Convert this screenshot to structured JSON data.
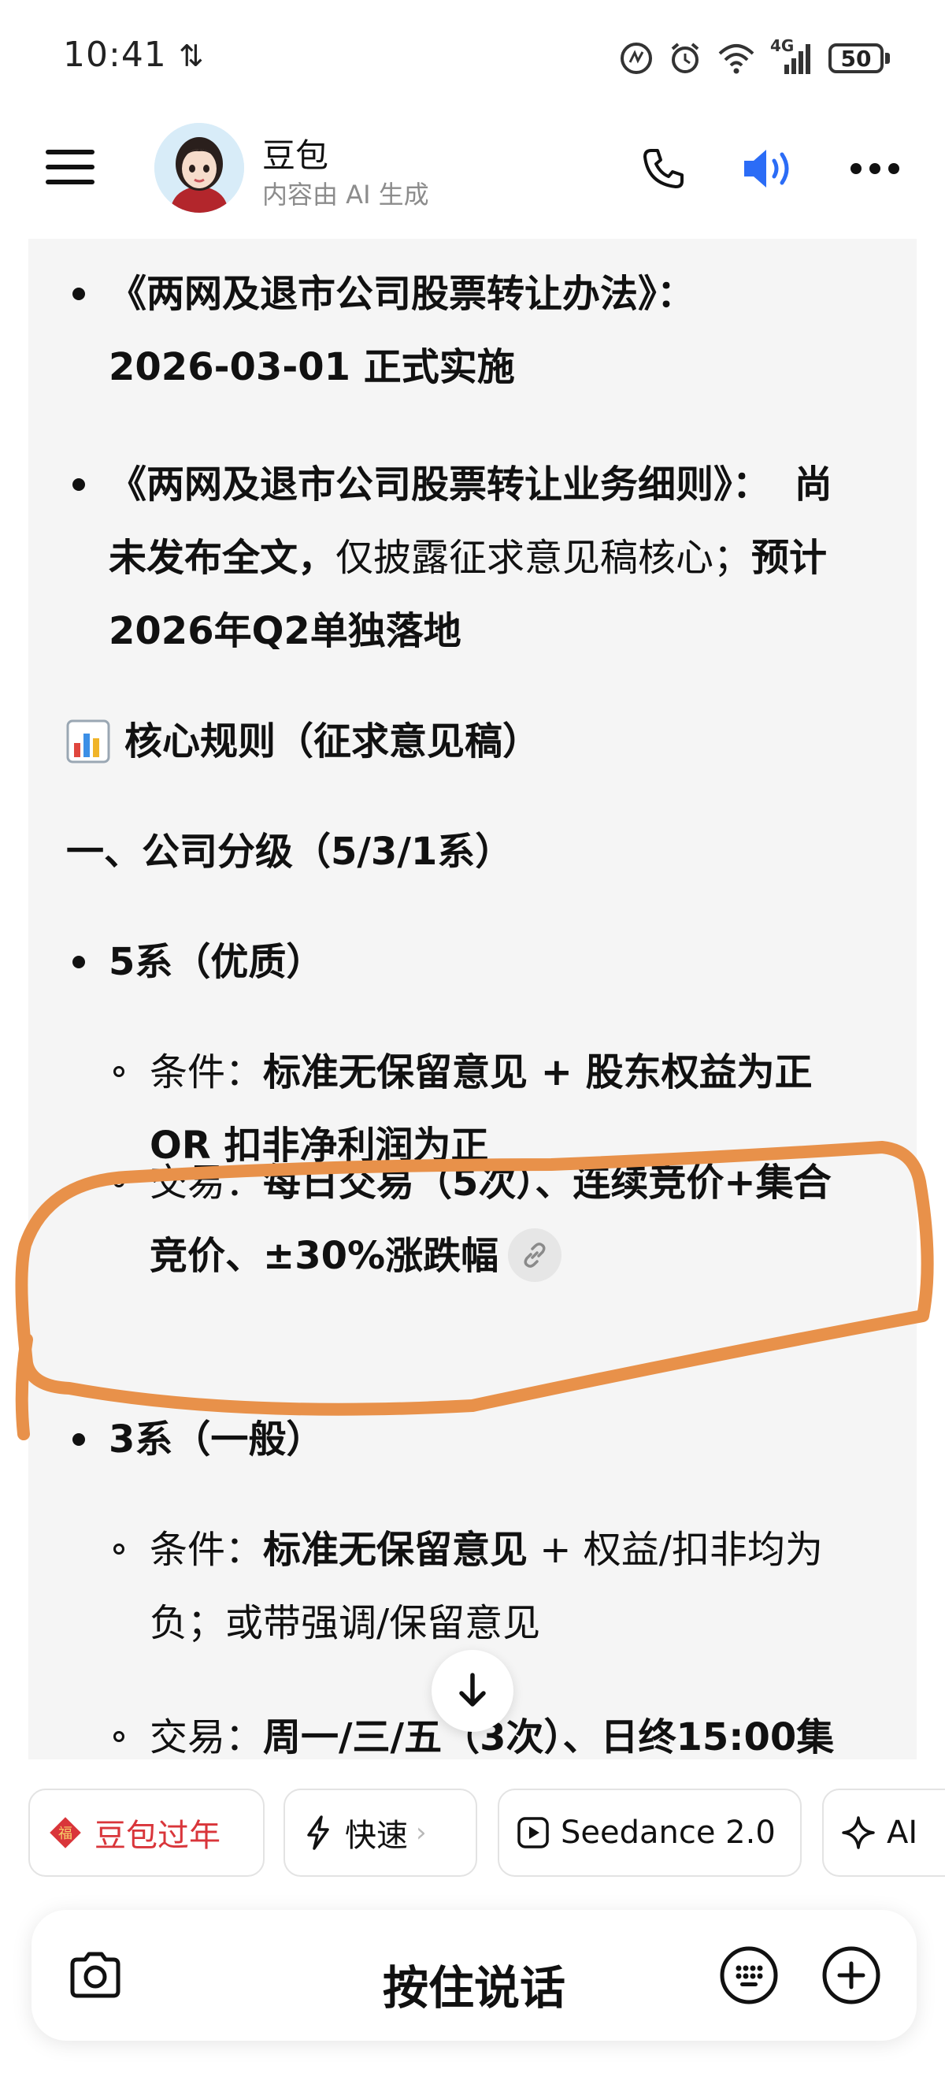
{
  "status_bar": {
    "time": "10:41",
    "network_arrows": "⇅",
    "network_type": "4G",
    "battery": "50"
  },
  "header": {
    "bot_name": "豆包",
    "subtitle": "内容由 AI 生成",
    "icons": [
      "menu-icon",
      "phone-icon",
      "speaker-icon",
      "more-icon"
    ],
    "accent_color": "#2b6cf6"
  },
  "content": {
    "item1_title": "《两网及退市公司股票转让办法》：",
    "item1_detail": "2026-03-01 正式实施",
    "item2_title": "《两网及退市公司股票转让业务细则》：",
    "item2_tail": "尚",
    "item2_line2_a": "未发布全文，",
    "item2_line2_b": "仅披露征求意见稿核心；",
    "item2_line2_c": "预计",
    "item2_line3": "2026年Q2单独落地",
    "section_heading": "核心规则（征求意见稿）",
    "subheading": "一、公司分级（5/3/1系）",
    "tier5": {
      "title": "5系（优质）",
      "cond_label": "条件：",
      "cond_line1": "标准无保留意见 + 股东权益为正",
      "cond_line2": "OR 扣非净利润为正",
      "trade_label": "交易：",
      "trade_line1": "每日交易（5次）、连续竞价+集合",
      "trade_line2": "竞价、±30%涨跌幅"
    },
    "tier3": {
      "title": "3系（一般）",
      "cond_label": "条件：",
      "cond_bold": "标准无保留意见",
      "cond_rest": " + 权益/扣非均为",
      "cond_line2": "负；或带强调/保留意见",
      "trade_label": "交易：",
      "trade_line1": "周一/三/五（3次）、日终15:00集"
    }
  },
  "chips": [
    {
      "label": "豆包过年",
      "icon": "fu-icon",
      "color": "#d9353a"
    },
    {
      "label": "快速",
      "icon": "lightning-icon"
    },
    {
      "label": "Seedance 2.0",
      "icon": "play-icon"
    },
    {
      "label": "AI",
      "icon": "sparkle-icon"
    }
  ],
  "input_bar": {
    "hold_to_talk": "按住说话"
  },
  "annotation_color": "#e8914a"
}
